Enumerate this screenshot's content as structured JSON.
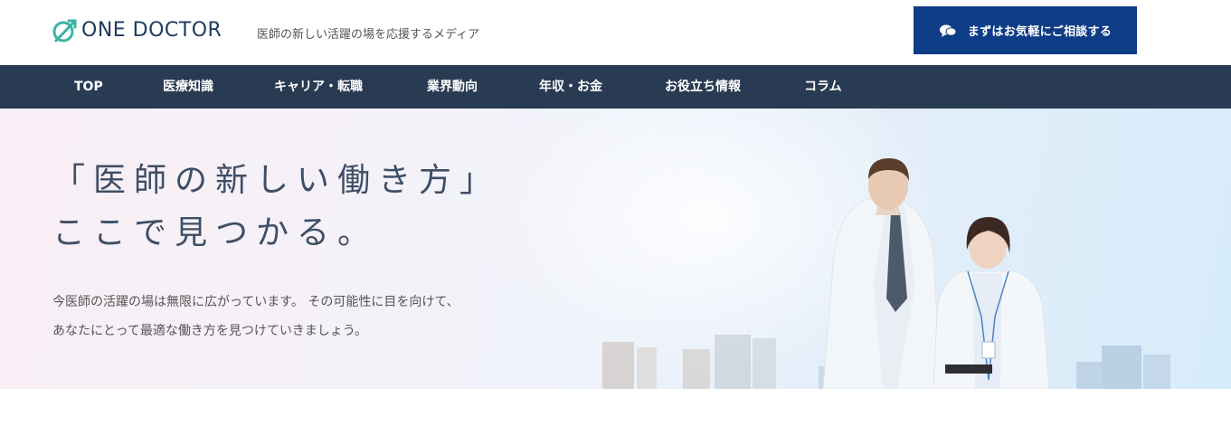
{
  "header": {
    "logo_text": "ONE DOCTOR",
    "tagline": "医師の新しい活躍の場を応援するメディア",
    "cta_label": "まずはお気軽にご相談する",
    "cta_icon": "chat-bubble-icon"
  },
  "nav": {
    "items": [
      {
        "label": "TOP"
      },
      {
        "label": "医療知識"
      },
      {
        "label": "キャリア・転職"
      },
      {
        "label": "業界動向"
      },
      {
        "label": "年収・お金"
      },
      {
        "label": "お役立ち情報"
      },
      {
        "label": "コラム"
      }
    ]
  },
  "hero": {
    "heading_line1": "「医師の新しい働き方」",
    "heading_line2": "ここで見つかる。",
    "desc_line1": "今医師の活躍の場は無限に広がっています。 その可能性に目を向けて、",
    "desc_line2": "あなたにとって最適な働き方を見つけていきましょう。"
  },
  "colors": {
    "brand": "#0f3c86",
    "nav_bg": "#283b52",
    "heading": "#3e4f66",
    "logo_accent": "#3bb3a6"
  }
}
